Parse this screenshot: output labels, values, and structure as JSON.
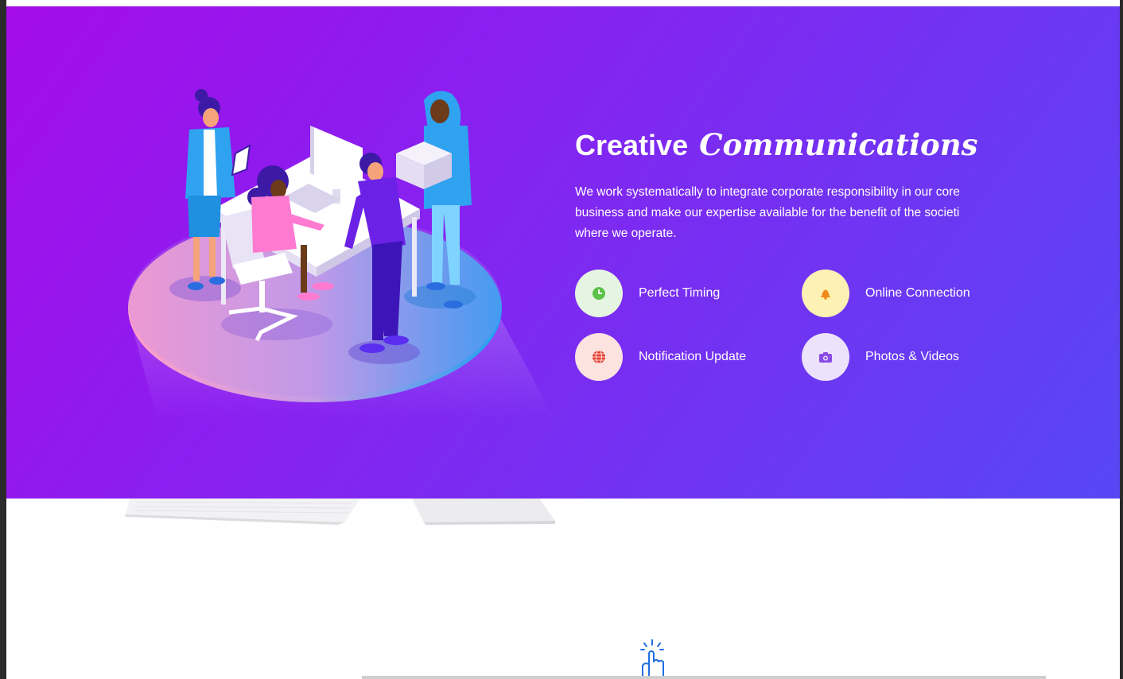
{
  "hero": {
    "title_plain": "Creative",
    "title_accent": "Communications",
    "description": "We work systematically to integrate corporate responsibility in our core business and make our expertise available for the benefit of the societi where we operate.",
    "features": [
      {
        "label": "Perfect Timing",
        "icon": "clock-icon",
        "bg": "#e6f5e1",
        "color": "#5cc24a"
      },
      {
        "label": "Online Connection",
        "icon": "bell-icon",
        "bg": "#fdf1b3",
        "color": "#f08a1a"
      },
      {
        "label": "Notification Update",
        "icon": "globe-icon",
        "bg": "#fde3df",
        "color": "#e23b2e"
      },
      {
        "label": "Photos & Videos",
        "icon": "camera-icon",
        "bg": "#ece2fb",
        "color": "#8a4be6"
      }
    ]
  },
  "colors": {
    "gradient_start": "#a40ce8",
    "gradient_end": "#5747f5",
    "hand_icon": "#1f6fe0"
  }
}
